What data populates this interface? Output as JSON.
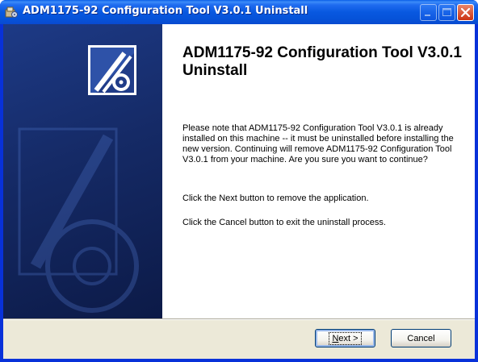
{
  "window": {
    "title": "ADM1175-92 Configuration Tool V3.0.1 Uninstall",
    "icons": {
      "app": "installer-icon",
      "minimize": "minimize-icon",
      "maximize": "maximize-icon",
      "close": "close-icon"
    }
  },
  "side_panel": {
    "logo": "installer-cd-logo"
  },
  "content": {
    "heading": "ADM1175-92 Configuration Tool V3.0.1 Uninstall",
    "paragraph1": "Please note that ADM1175-92 Configuration Tool V3.0.1 is already installed on this machine -- it must be uninstalled before installing the new version. Continuing will remove ADM1175-92 Configuration Tool V3.0.1 from your machine. Are you sure you want to continue?",
    "paragraph2": "Click the Next button to remove the application.",
    "paragraph3": "Click the Cancel button to exit the uninstall process."
  },
  "buttons": {
    "next_accel": "N",
    "next_rest": "ext >",
    "cancel": "Cancel"
  },
  "colors": {
    "titlebar": "#0a5ee8",
    "side_panel": "#152a66",
    "dialog_bg": "#ece9d8"
  }
}
